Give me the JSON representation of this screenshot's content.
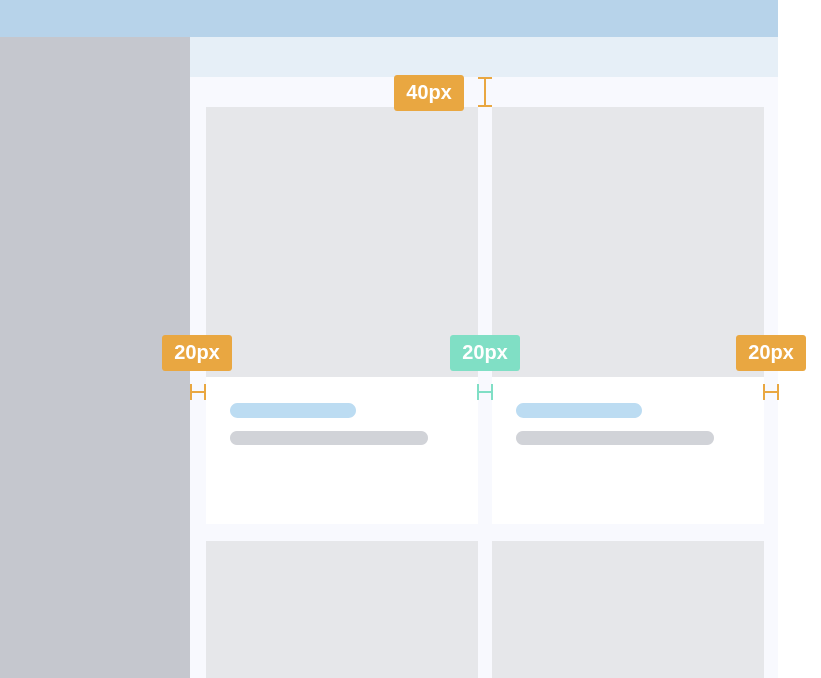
{
  "colors": {
    "topbar": "#b7d3ea",
    "sidebar": "#c5c7ce",
    "content_header": "#e6eff7",
    "content_bg": "#f8f9fe",
    "card_image": "#e6e7ea",
    "card_body": "#ffffff",
    "title_pill": "#bcdcf2",
    "text_pill": "#d1d3d8",
    "orange": "#e9a741",
    "teal": "#80dfc5"
  },
  "annotations": {
    "top_spacing": "40px",
    "left_margin": "20px",
    "gutter": "20px",
    "right_margin": "20px"
  }
}
